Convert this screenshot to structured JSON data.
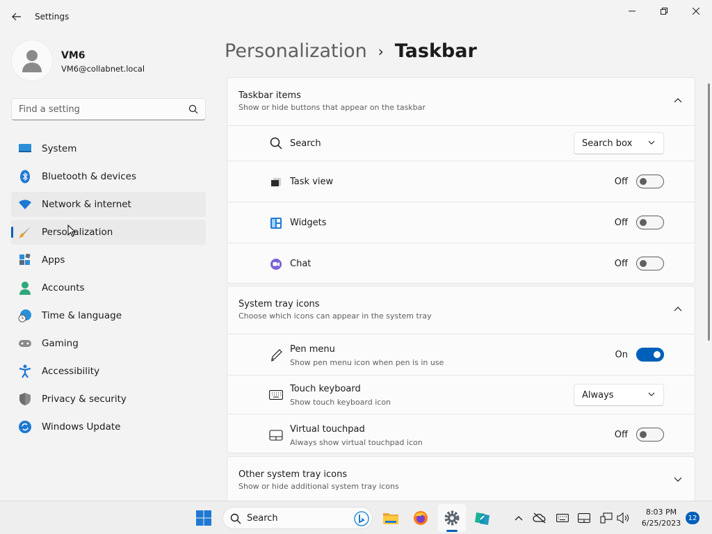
{
  "window": {
    "title": "Settings"
  },
  "user": {
    "name": "VM6",
    "email": "VM6@collabnet.local"
  },
  "search": {
    "placeholder": "Find a setting"
  },
  "nav": {
    "items": [
      {
        "label": "System"
      },
      {
        "label": "Bluetooth & devices"
      },
      {
        "label": "Network & internet"
      },
      {
        "label": "Personalization"
      },
      {
        "label": "Apps"
      },
      {
        "label": "Accounts"
      },
      {
        "label": "Time & language"
      },
      {
        "label": "Gaming"
      },
      {
        "label": "Accessibility"
      },
      {
        "label": "Privacy & security"
      },
      {
        "label": "Windows Update"
      }
    ]
  },
  "breadcrumb": {
    "parent": "Personalization",
    "separator": "›",
    "current": "Taskbar"
  },
  "taskbar_items": {
    "title": "Taskbar items",
    "subtitle": "Show or hide buttons that appear on the taskbar",
    "rows": {
      "search": {
        "label": "Search",
        "value": "Search box"
      },
      "task_view": {
        "label": "Task view",
        "state": "Off"
      },
      "widgets": {
        "label": "Widgets",
        "state": "Off"
      },
      "chat": {
        "label": "Chat",
        "state": "Off"
      }
    }
  },
  "system_tray": {
    "title": "System tray icons",
    "subtitle": "Choose which icons can appear in the system tray",
    "rows": {
      "pen_menu": {
        "label": "Pen menu",
        "sub": "Show pen menu icon when pen is in use",
        "state": "On"
      },
      "touch_keyboard": {
        "label": "Touch keyboard",
        "sub": "Show touch keyboard icon",
        "value": "Always"
      },
      "virtual_touchpad": {
        "label": "Virtual touchpad",
        "sub": "Always show virtual touchpad icon",
        "state": "Off"
      }
    }
  },
  "other_tray": {
    "title": "Other system tray icons",
    "subtitle": "Show or hide additional system tray icons"
  },
  "os_taskbar": {
    "search_label": "Search",
    "time": "8:03 PM",
    "date": "6/25/2023",
    "notifications": "12"
  },
  "colors": {
    "accent": "#005fb8",
    "background": "#f3f3f3",
    "card": "#fbfbfb"
  }
}
